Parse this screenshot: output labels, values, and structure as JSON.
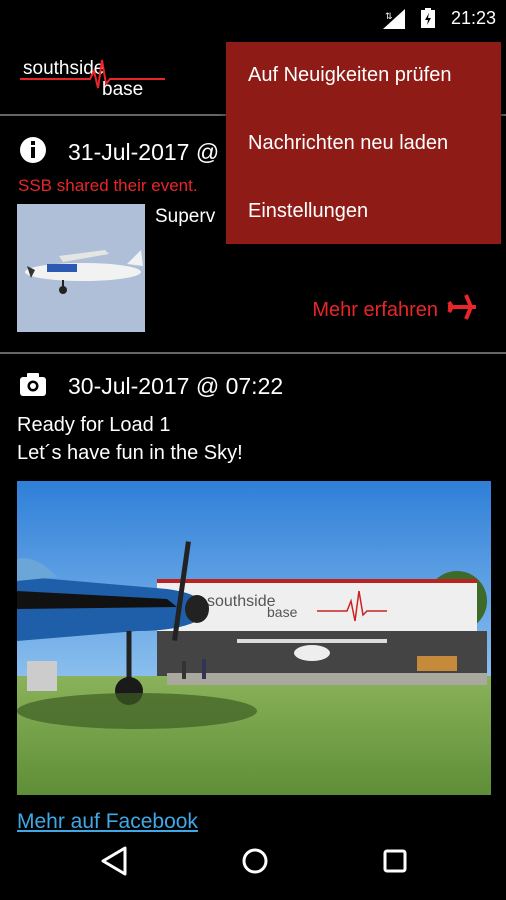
{
  "status": {
    "time": "21:23"
  },
  "menu": {
    "items": [
      "Auf Neuigkeiten prüfen",
      "Nachrichten neu laden",
      "Einstellungen"
    ]
  },
  "posts": [
    {
      "icon": "info-icon",
      "date": "31-Jul-2017 @",
      "shared": "SSB shared their event.",
      "event_title": "Superv",
      "more_label": "Mehr erfahren"
    },
    {
      "icon": "camera-icon",
      "date": "30-Jul-2017 @ 07:22",
      "text_line1": "Ready for Load 1",
      "text_line2": "Let´s have fun in the Sky!",
      "link": "Mehr auf Facebook"
    }
  ],
  "colors": {
    "accent_red": "#e8262a",
    "menu_bg": "#8e1b15",
    "link_blue": "#3fa8e6"
  }
}
